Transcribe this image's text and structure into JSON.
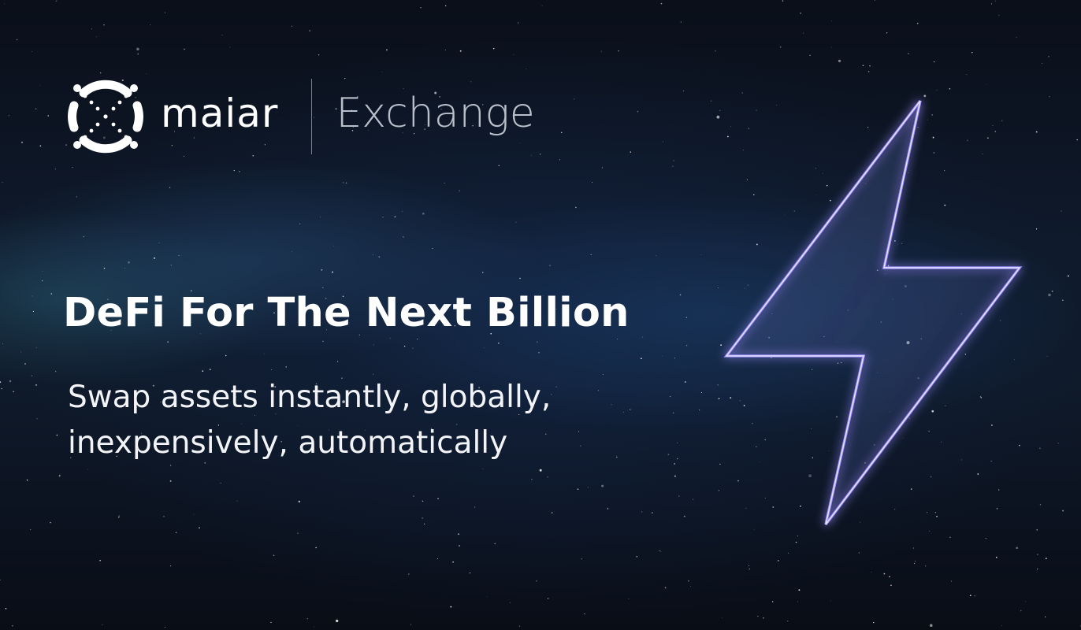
{
  "brand": {
    "name": "maiar",
    "product": "Exchange",
    "logo_icon": "maiar-logo-icon"
  },
  "hero": {
    "headline": "DeFi For The Next Billion",
    "subline_1": "Swap assets instantly, globally,",
    "subline_2": "inexpensively, automatically"
  },
  "decoration": {
    "bolt_icon": "lightning-bolt-icon"
  },
  "colors": {
    "background": "#0b111c",
    "text": "#ffffff",
    "bolt_glow": "#8a7dff"
  }
}
